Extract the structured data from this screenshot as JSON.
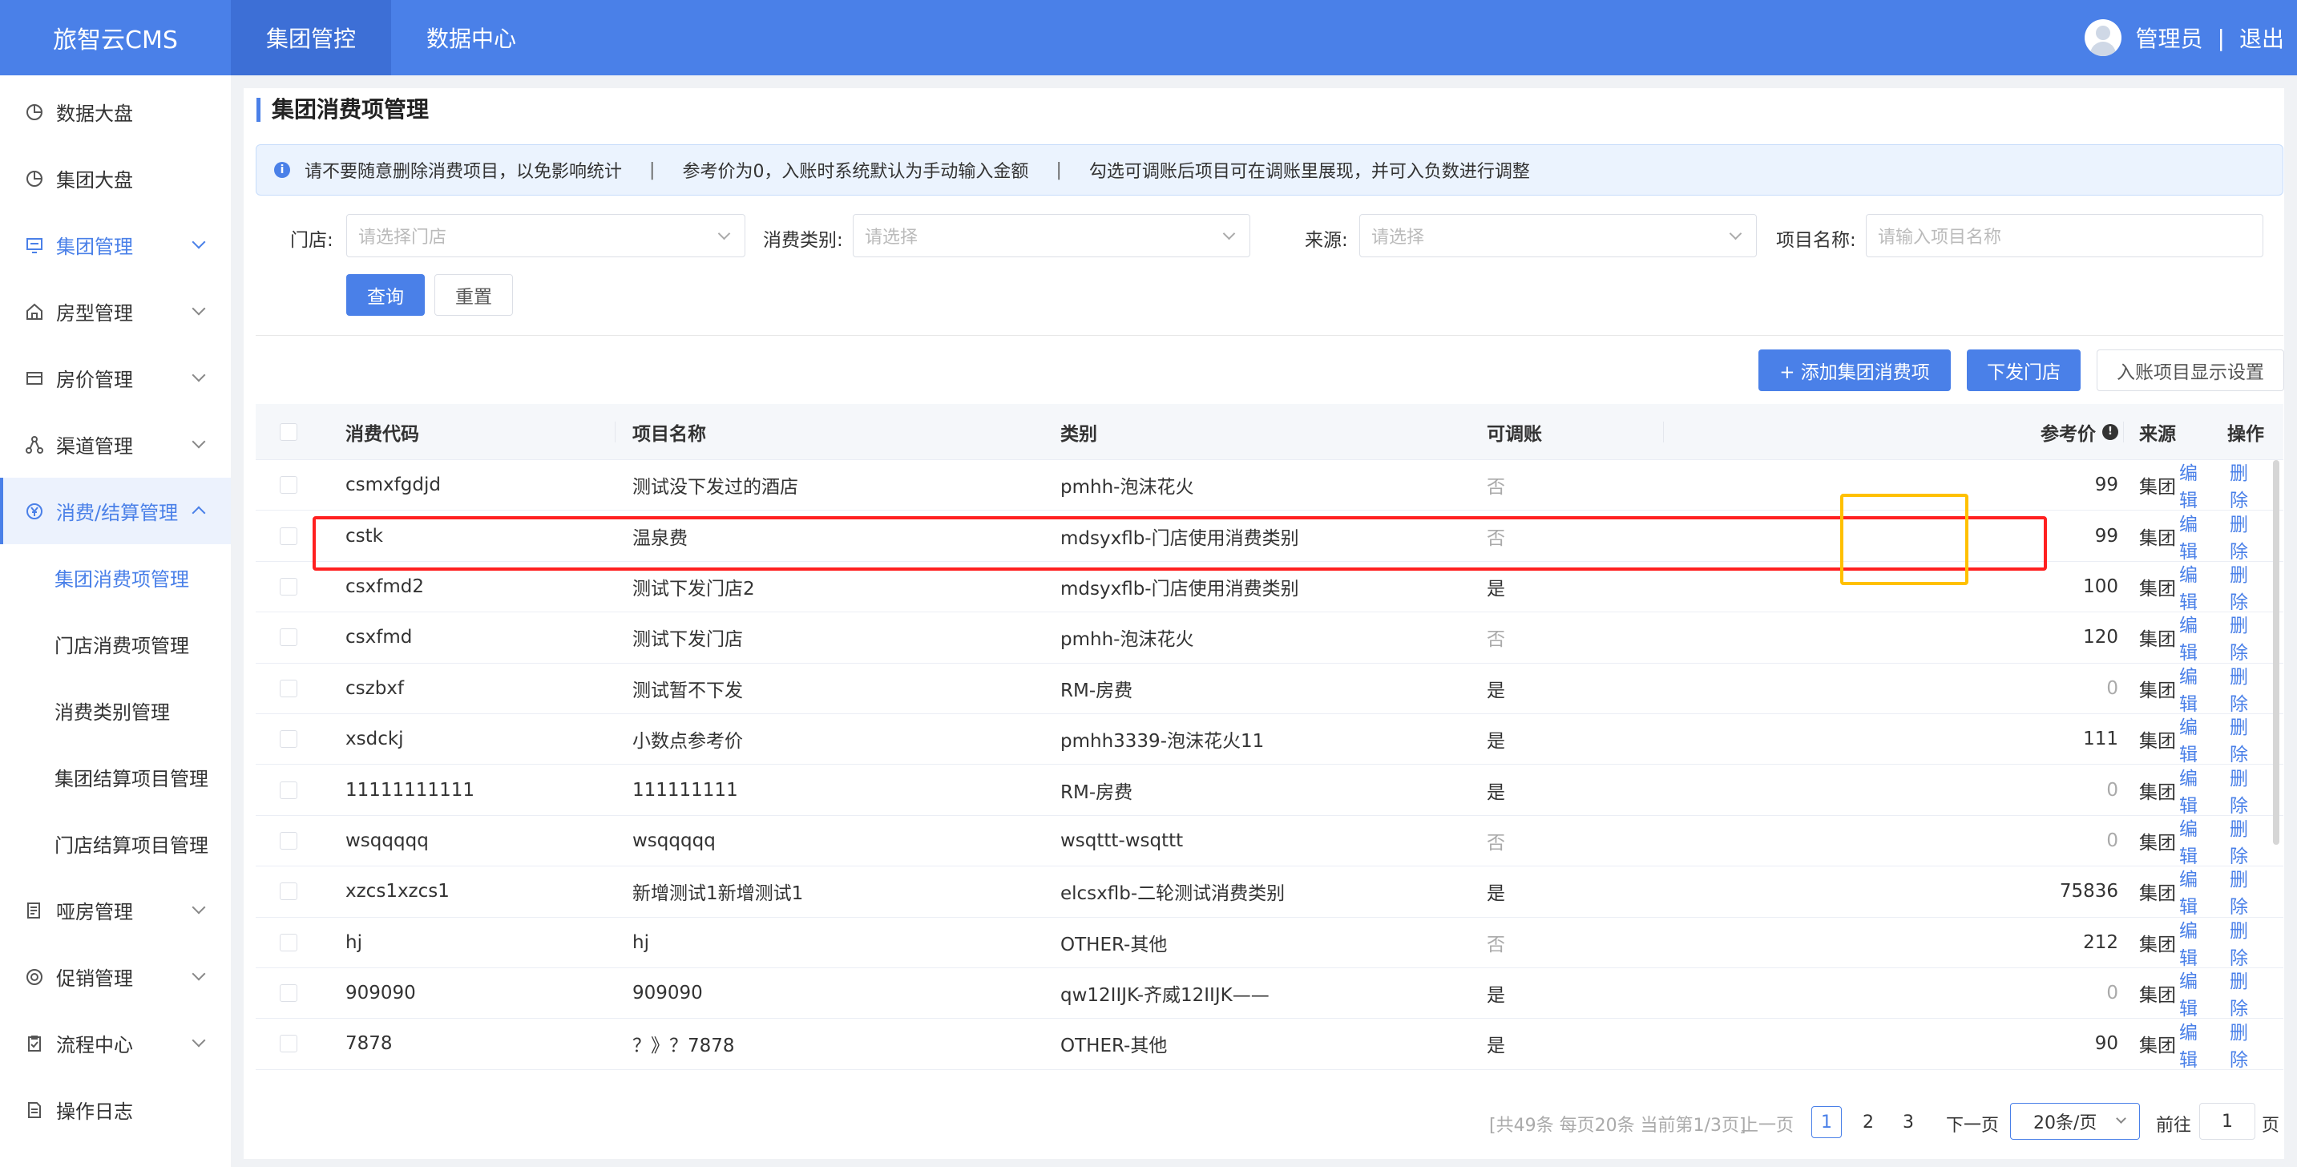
{
  "topbar": {
    "brand": "旅智云CMS",
    "nav": [
      "集团管控",
      "数据中心"
    ],
    "user": "管理员",
    "separator": "|",
    "logout": "退出"
  },
  "sidebar": {
    "items": [
      {
        "label": "数据大盘",
        "icon": "pie-chart-icon"
      },
      {
        "label": "集团大盘",
        "icon": "pie-chart-icon"
      },
      {
        "label": "集团管理",
        "icon": "monitor-icon"
      },
      {
        "label": "房型管理",
        "icon": "home-icon"
      },
      {
        "label": "房价管理",
        "icon": "wallet-icon"
      },
      {
        "label": "渠道管理",
        "icon": "network-icon"
      },
      {
        "label": "消费/结算管理",
        "icon": "yen-icon"
      },
      {
        "label": "哑房管理",
        "icon": "document-icon"
      },
      {
        "label": "促销管理",
        "icon": "promo-icon"
      },
      {
        "label": "流程中心",
        "icon": "clipboard-icon"
      },
      {
        "label": "操作日志",
        "icon": "log-icon"
      }
    ],
    "sub_items": [
      "集团消费项管理",
      "门店消费项管理",
      "消费类别管理",
      "集团结算项目管理",
      "门店结算项目管理"
    ]
  },
  "page": {
    "title": "集团消费项管理",
    "notice": [
      "请不要随意删除消费项目，以免影响统计",
      "|",
      "参考价为0，入账时系统默认为手动输入金额",
      "|",
      "勾选可调账后项目可在调账里展现，并可入负数进行调整"
    ]
  },
  "filters": {
    "store_label": "门店:",
    "store_placeholder": "请选择门店",
    "category_label": "消费类别:",
    "category_placeholder": "请选择",
    "source_label": "来源:",
    "source_placeholder": "请选择",
    "name_label": "项目名称:",
    "name_placeholder": "请输入项目名称",
    "query": "查询",
    "reset": "重置"
  },
  "toolbar": {
    "add": "+ 添加集团消费项",
    "dispatch": "下发门店",
    "display_settings": "入账项目显示设置"
  },
  "table": {
    "headers": {
      "code": "消费代码",
      "name": "项目名称",
      "category": "类别",
      "adjustable": "可调账",
      "price": "参考价",
      "source": "来源",
      "ops": "操作"
    },
    "edit": "编辑",
    "delete": "删除",
    "rows": [
      {
        "code": "csmxfgdjd",
        "name": "测试没下发过的酒店",
        "category": "pmhh-泡沫花火",
        "adjustable": "否",
        "price": "99",
        "source": "集团"
      },
      {
        "code": "cstk",
        "name": "温泉费",
        "category": "mdsyxflb-门店使用消费类别",
        "adjustable": "否",
        "price": "99",
        "source": "集团"
      },
      {
        "code": "csxfmd2",
        "name": "测试下发门店2",
        "category": "mdsyxflb-门店使用消费类别",
        "adjustable": "是",
        "price": "100",
        "source": "集团"
      },
      {
        "code": "csxfmd",
        "name": "测试下发门店",
        "category": "pmhh-泡沫花火",
        "adjustable": "否",
        "price": "120",
        "source": "集团"
      },
      {
        "code": "cszbxf",
        "name": "测试暂不下发",
        "category": "RM-房费",
        "adjustable": "是",
        "price": "0",
        "source": "集团"
      },
      {
        "code": "xsdckj",
        "name": "小数点参考价",
        "category": "pmhh3339-泡沫花火11",
        "adjustable": "是",
        "price": "111",
        "source": "集团"
      },
      {
        "code": "11111111111",
        "name": "111111111",
        "category": "RM-房费",
        "adjustable": "是",
        "price": "0",
        "source": "集团"
      },
      {
        "code": "wsqqqqq",
        "name": "wsqqqqq",
        "category": "wsqttt-wsqttt",
        "adjustable": "否",
        "price": "0",
        "source": "集团"
      },
      {
        "code": "xzcs1xzcs1",
        "name": "新增测试1新增测试1",
        "category": "elcsxflb-二轮测试消费类别",
        "adjustable": "是",
        "price": "75836",
        "source": "集团"
      },
      {
        "code": "hj",
        "name": "hj",
        "category": "OTHER-其他",
        "adjustable": "否",
        "price": "212",
        "source": "集团"
      },
      {
        "code": "909090",
        "name": "909090",
        "category": "qw12IIJK-齐威12IIJK——",
        "adjustable": "是",
        "price": "0",
        "source": "集团"
      },
      {
        "code": "7878",
        "name": "？》？7878",
        "category": "OTHER-其他",
        "adjustable": "是",
        "price": "90",
        "source": "集团"
      }
    ]
  },
  "pagination": {
    "summary": "[共49条 每页20条 当前第1/3页]",
    "prev": "上一页",
    "pages": [
      "1",
      "2",
      "3"
    ],
    "next": "下一页",
    "page_size": "20条/页",
    "goto": "前往",
    "goto_value": "1",
    "page_unit": "页"
  },
  "colors": {
    "accent": "#4a80e8",
    "highlight_red": "#ff2020",
    "highlight_yellow": "#ffc000"
  }
}
